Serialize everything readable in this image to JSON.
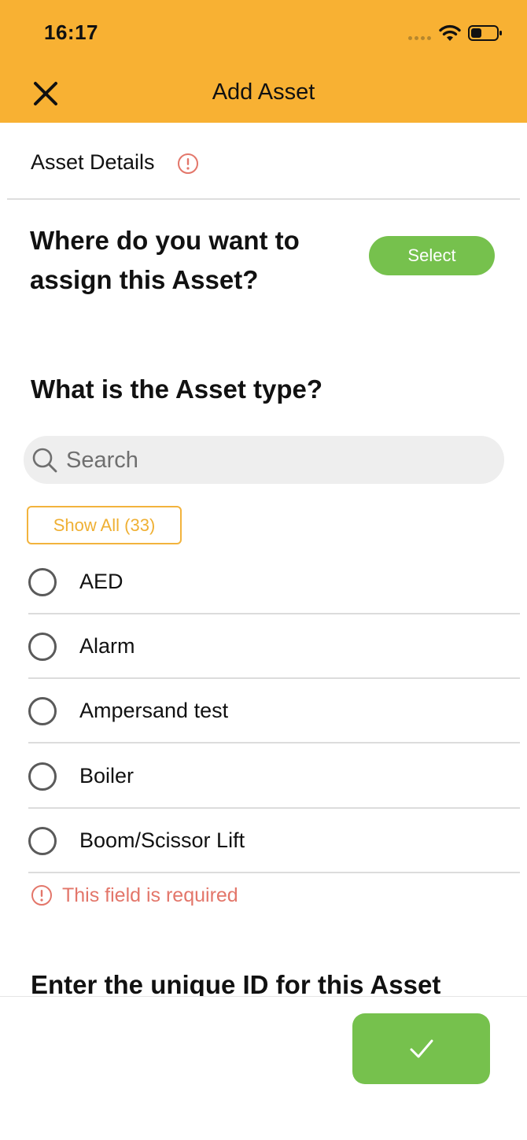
{
  "status_bar": {
    "time": "16:17"
  },
  "header": {
    "title": "Add Asset"
  },
  "section": {
    "title": "Asset Details"
  },
  "assign": {
    "question": "Where do you want to assign this Asset?",
    "select_label": "Select"
  },
  "asset_type": {
    "question": "What is the Asset type?",
    "search_placeholder": "Search",
    "show_all_label": "Show All (33)",
    "items": [
      {
        "label": "AED"
      },
      {
        "label": "Alarm"
      },
      {
        "label": "Ampersand test"
      },
      {
        "label": "Boiler"
      },
      {
        "label": "Boom/Scissor Lift"
      }
    ],
    "error": "This field is required"
  },
  "unique_id": {
    "question": "Enter the unique ID for this Asset"
  },
  "colors": {
    "header": "#F8B133",
    "accent_green": "#76C14D",
    "error": "#E3766A",
    "show_all": "#EFB034"
  }
}
